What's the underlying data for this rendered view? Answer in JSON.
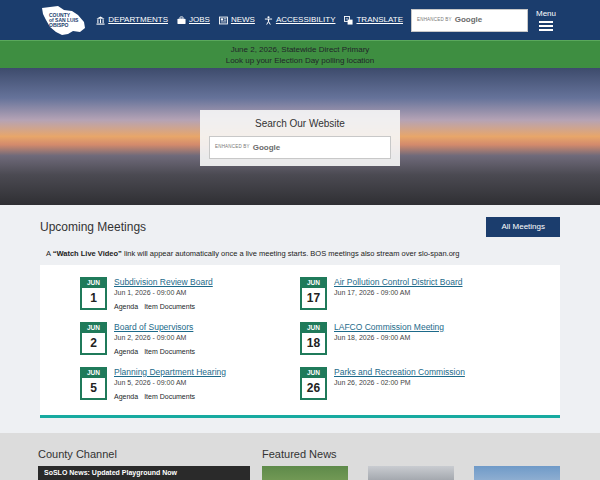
{
  "header": {
    "logo": [
      "COUNTY",
      "of SAN LUIS",
      "OBISPO"
    ],
    "nav": [
      {
        "label": "DEPARTMENTS",
        "kind": "building"
      },
      {
        "label": "JOBS",
        "kind": "briefcase"
      },
      {
        "label": "NEWS",
        "kind": "newspaper"
      },
      {
        "label": "ACCESSIBILITY",
        "kind": "accessibility"
      },
      {
        "label": "TRANSLATE",
        "kind": "translate"
      }
    ],
    "search": {
      "note": "ENHANCED BY",
      "brand": "Google"
    },
    "menu": "Menu"
  },
  "alert": {
    "lines": [
      "June 2, 2026, Statewide Direct Primary",
      "Look up your Election Day polling location"
    ]
  },
  "hero": {
    "title": "Search Our Website",
    "search": {
      "note": "ENHANCED BY",
      "brand": "Google"
    }
  },
  "meetings": {
    "title": "Upcoming Meetings",
    "button": "All Meetings",
    "note": {
      "prefix": "A ",
      "bold": "“Watch Live Video”",
      "middle": " link will appear automatically once a live meeting starts. BOS meetings also stream over ",
      "link": "slo-span.org"
    },
    "columns": [
      [
        {
          "month": "JUN",
          "day": "1",
          "title": "Subdivision Review Board",
          "date": "Jun 1, 2026 - 09:00 AM",
          "links": [
            "Agenda",
            "Item Documents"
          ]
        },
        {
          "month": "JUN",
          "day": "2",
          "title": "Board of Supervisors",
          "date": "Jun 2, 2026 - 09:00 AM",
          "links": [
            "Agenda",
            "Item Documents"
          ]
        },
        {
          "month": "JUN",
          "day": "5",
          "title": "Planning Department Hearing",
          "date": "Jun 5, 2026 - 09:00 AM",
          "links": [
            "Agenda",
            "Item Documents"
          ]
        }
      ],
      [
        {
          "month": "JUN",
          "day": "17",
          "title": "Air Pollution Control District Board",
          "date": "Jun 17, 2026 - 09:00 AM",
          "links": []
        },
        {
          "month": "JUN",
          "day": "18",
          "title": "LAFCO Commission Meeting",
          "date": "Jun 18, 2026 - 09:00 AM",
          "links": []
        },
        {
          "month": "JUN",
          "day": "26",
          "title": "Parks and Recreation Commission",
          "date": "Jun 26, 2026 - 02:00 PM",
          "links": []
        }
      ]
    ]
  },
  "bottom": {
    "channel": {
      "title": "County Channel",
      "video": "SoSLO News: Updated Playground Now"
    },
    "news": {
      "title": "Featured News"
    }
  }
}
